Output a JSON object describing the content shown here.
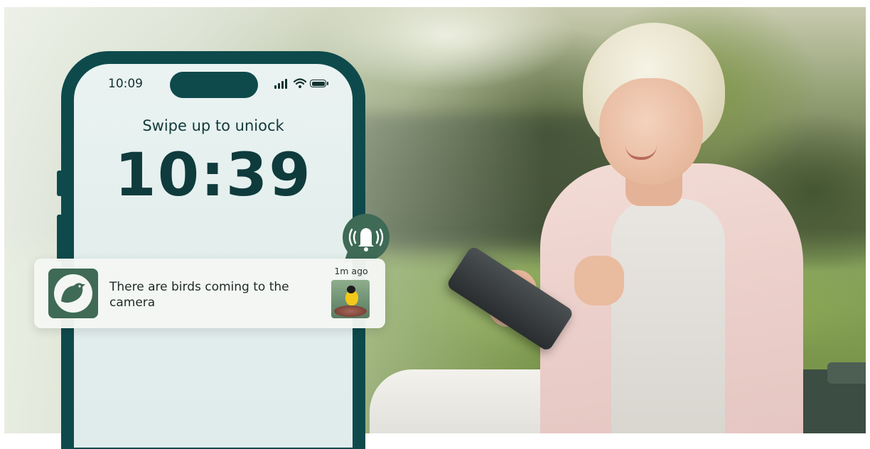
{
  "phone": {
    "status_time": "10:09",
    "swipe_text": "Swipe up to uniock",
    "clock": "10:39"
  },
  "notification": {
    "app_icon": "bird-icon",
    "message": "There are birds coming to the camera",
    "time_ago": "1m ago",
    "thumbnail": "bird-feeder-thumbnail"
  },
  "bell": {
    "icon": "ringing-bell-icon"
  },
  "colors": {
    "phone_frame": "#0e4a4c",
    "screen": "#e4efed",
    "app_icon_bg": "#3e6a56",
    "bubble": "#3e6a56"
  }
}
